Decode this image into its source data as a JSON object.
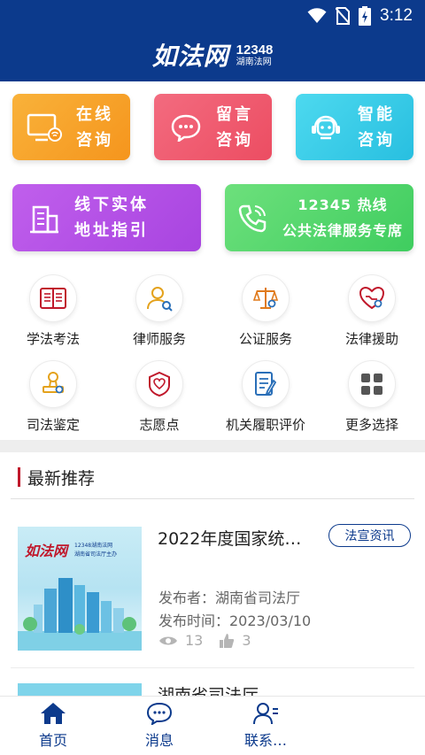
{
  "status_bar": {
    "time": "3:12"
  },
  "header": {
    "brand": "如法网",
    "number": "12348",
    "tagline": "湖南法网"
  },
  "feature_cards": [
    {
      "line1": "在线",
      "line2": "咨询"
    },
    {
      "line1": "留言",
      "line2": "咨询"
    },
    {
      "line1": "智能",
      "line2": "咨询"
    },
    {
      "line1": "线下实体",
      "line2": "地址指引"
    },
    {
      "line1": "12345 热线",
      "line2": "公共法律服务专席"
    }
  ],
  "services": [
    {
      "label": "学法考法",
      "icon": "book-icon"
    },
    {
      "label": "律师服务",
      "icon": "lawyer-icon"
    },
    {
      "label": "公证服务",
      "icon": "scales-icon"
    },
    {
      "label": "法律援助",
      "icon": "heart-hand-icon"
    },
    {
      "label": "司法鉴定",
      "icon": "stamp-icon"
    },
    {
      "label": "志愿点",
      "icon": "volunteer-badge-icon"
    },
    {
      "label": "机关履职评价",
      "icon": "document-edit-icon"
    },
    {
      "label": "更多选择",
      "icon": "grid-icon"
    }
  ],
  "recommend": {
    "title": "最新推荐"
  },
  "news": [
    {
      "title": "2022年度国家统…",
      "tag": "法宣资讯",
      "publisher": "发布者：湖南省司法厅",
      "date": "发布时间：2023/03/10",
      "views": "13",
      "likes": "3",
      "thumb_brand": "如法网",
      "thumb_line1": "12348湖南法网",
      "thumb_line2": "湖南省司法厅主办"
    },
    {
      "title": "湖南省司法厅…"
    }
  ],
  "bottom_nav": [
    {
      "label": "首页"
    },
    {
      "label": "消息"
    },
    {
      "label": "联系…"
    }
  ],
  "colors": {
    "primary": "#0c3a8c",
    "accent_red": "#c0182b"
  }
}
